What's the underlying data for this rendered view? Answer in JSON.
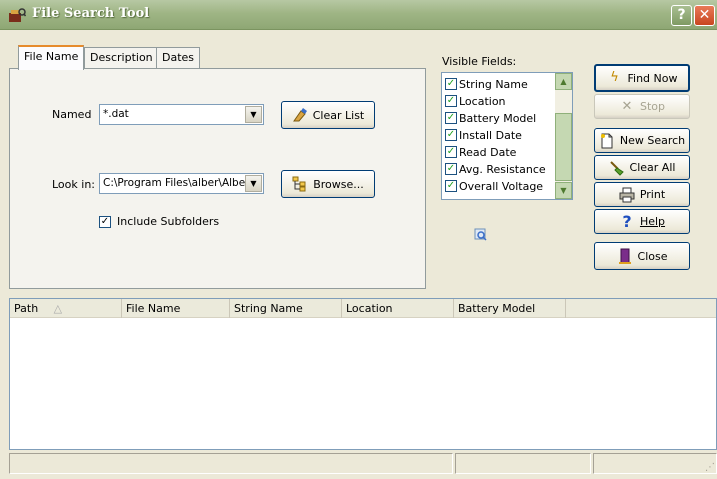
{
  "window": {
    "title": "File Search Tool",
    "help_glyph": "?",
    "close_glyph": "✕"
  },
  "tabs": [
    {
      "label": "File Name",
      "active": true
    },
    {
      "label": "Description",
      "active": false
    },
    {
      "label": "Dates",
      "active": false
    }
  ],
  "form": {
    "named_label": "Named",
    "named_value": "*.dat",
    "clear_list_label": "Clear List",
    "look_in_label": "Look in:",
    "look_in_value": "C:\\Program Files\\alber\\Albe",
    "browse_label": "Browse...",
    "include_subfolders_label": "Include Subfolders",
    "include_subfolders_checked": true
  },
  "visible_fields": {
    "label": "Visible Fields:",
    "items": [
      {
        "label": "String Name",
        "checked": true
      },
      {
        "label": "Location",
        "checked": true
      },
      {
        "label": "Battery Model",
        "checked": true
      },
      {
        "label": "Install Date",
        "checked": true
      },
      {
        "label": "Read Date",
        "checked": true
      },
      {
        "label": "Avg. Resistance",
        "checked": true
      },
      {
        "label": "Overall Voltage",
        "checked": true
      }
    ]
  },
  "actions": {
    "find_now": "Find Now",
    "stop": "Stop",
    "new_search": "New Search",
    "clear_all": "Clear All",
    "print": "Print",
    "help": "Help",
    "close": "Close"
  },
  "results": {
    "columns": [
      "Path",
      "File Name",
      "String Name",
      "Location",
      "Battery Model"
    ],
    "sort_column": "Path",
    "rows": []
  },
  "colors": {
    "titlebar": "#9fb585",
    "tab_highlight": "#e68b2c",
    "button_border": "#003c74"
  }
}
